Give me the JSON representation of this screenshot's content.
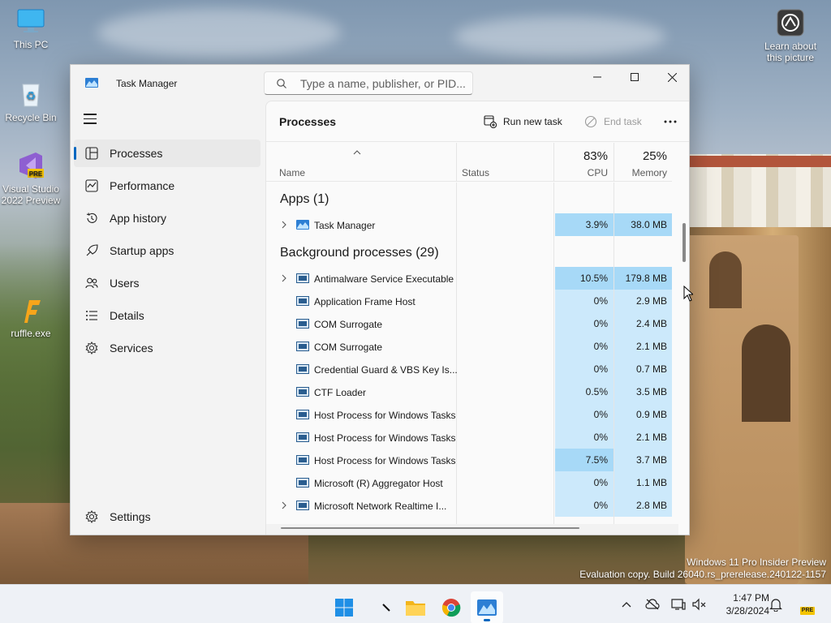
{
  "desktop": {
    "icons": [
      {
        "label": "This PC"
      },
      {
        "label": "Recycle Bin"
      },
      {
        "label": "Visual Studio 2022 Preview",
        "badge": "PRE"
      },
      {
        "label": "ruffle.exe"
      },
      {
        "label": "Learn about this picture"
      }
    ],
    "watermark": {
      "line1": "Windows 11 Pro Insider Preview",
      "line2": "Evaluation copy. Build 26040.rs_prerelease.240122-1157"
    }
  },
  "window": {
    "title": "Task Manager",
    "search_placeholder": "Type a name, publisher, or PID..."
  },
  "sidebar": {
    "items": [
      {
        "label": "Processes",
        "icon": "processes-icon",
        "active": true
      },
      {
        "label": "Performance",
        "icon": "performance-icon"
      },
      {
        "label": "App history",
        "icon": "history-icon"
      },
      {
        "label": "Startup apps",
        "icon": "startup-icon"
      },
      {
        "label": "Users",
        "icon": "users-icon"
      },
      {
        "label": "Details",
        "icon": "details-icon"
      },
      {
        "label": "Services",
        "icon": "services-icon"
      }
    ],
    "settings_label": "Settings"
  },
  "toolbar": {
    "page_title": "Processes",
    "run_new_task": "Run new task",
    "end_task": "End task"
  },
  "table": {
    "headers": {
      "name": "Name",
      "status": "Status",
      "cpu_pct": "83%",
      "cpu": "CPU",
      "mem_pct": "25%",
      "memory": "Memory"
    },
    "groups": {
      "apps": "Apps (1)",
      "background": "Background processes (29)"
    },
    "apps": [
      {
        "name": "Task Manager",
        "cpu": "3.9%",
        "mem": "38.0 MB",
        "expandable": true
      }
    ],
    "background": [
      {
        "name": "Antimalware Service Executable",
        "cpu": "10.5%",
        "mem": "179.8 MB",
        "expandable": true
      },
      {
        "name": "Application Frame Host",
        "cpu": "0%",
        "mem": "2.9 MB"
      },
      {
        "name": "COM Surrogate",
        "cpu": "0%",
        "mem": "2.4 MB"
      },
      {
        "name": "COM Surrogate",
        "cpu": "0%",
        "mem": "2.1 MB"
      },
      {
        "name": "Credential Guard & VBS Key Is...",
        "cpu": "0%",
        "mem": "0.7 MB"
      },
      {
        "name": "CTF Loader",
        "cpu": "0.5%",
        "mem": "3.5 MB"
      },
      {
        "name": "Host Process for Windows Tasks",
        "cpu": "0%",
        "mem": "0.9 MB"
      },
      {
        "name": "Host Process for Windows Tasks",
        "cpu": "0%",
        "mem": "2.1 MB"
      },
      {
        "name": "Host Process for Windows Tasks",
        "cpu": "7.5%",
        "mem": "3.7 MB"
      },
      {
        "name": "Microsoft (R) Aggregator Host",
        "cpu": "0%",
        "mem": "1.1 MB"
      },
      {
        "name": "Microsoft Network Realtime I...",
        "cpu": "0%",
        "mem": "2.8 MB",
        "expandable": true
      }
    ]
  },
  "taskbar": {
    "apps": [
      "start-icon",
      "search-cursor",
      "file-explorer-icon",
      "chrome-icon",
      "task-manager-icon"
    ],
    "time": "1:47 PM",
    "date": "3/28/2024",
    "tray_badge": "PRE"
  }
}
